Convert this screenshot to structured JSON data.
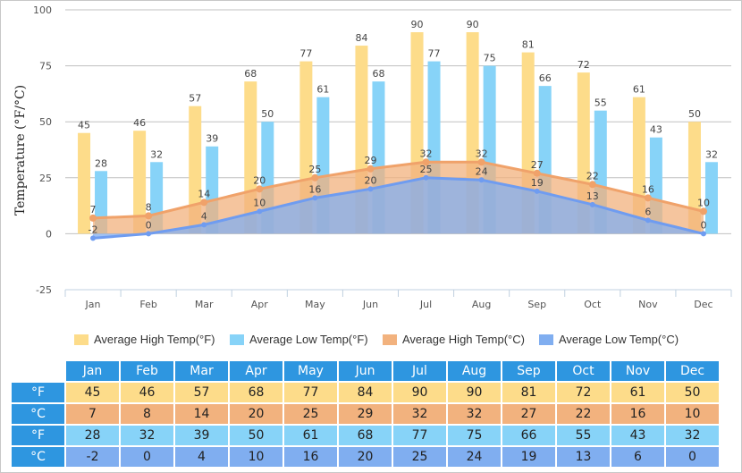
{
  "chart_data": {
    "type": "bar",
    "title": "",
    "xlabel": "",
    "ylabel": "Temperature (°F/°C)",
    "ylim": [
      -25,
      100
    ],
    "yticks": [
      -25,
      0,
      25,
      50,
      75,
      100
    ],
    "grid": true,
    "legend_position": "bottom",
    "categories": [
      "Jan",
      "Feb",
      "Mar",
      "Apr",
      "May",
      "Jun",
      "Jul",
      "Aug",
      "Sep",
      "Oct",
      "Nov",
      "Dec"
    ],
    "series": [
      {
        "name": "Average High Temp(°F)",
        "kind": "bar",
        "color": "#fddc8a",
        "values": [
          45,
          46,
          57,
          68,
          77,
          84,
          90,
          90,
          81,
          72,
          61,
          50
        ]
      },
      {
        "name": "Average Low Temp(°F)",
        "kind": "bar",
        "color": "#87d3f8",
        "values": [
          28,
          32,
          39,
          50,
          61,
          68,
          77,
          75,
          66,
          55,
          43,
          32
        ]
      },
      {
        "name": "Average High Temp(°C)",
        "kind": "area",
        "color": "#f2b27e",
        "values": [
          7,
          8,
          14,
          20,
          25,
          29,
          32,
          32,
          27,
          22,
          16,
          10
        ]
      },
      {
        "name": "Average Low Temp(°C)",
        "kind": "area",
        "color": "#80aef0",
        "values": [
          -2,
          0,
          4,
          10,
          16,
          20,
          25,
          24,
          19,
          13,
          6,
          0
        ]
      }
    ]
  },
  "table": {
    "months": [
      "Jan",
      "Feb",
      "Mar",
      "Apr",
      "May",
      "Jun",
      "Jul",
      "Aug",
      "Sep",
      "Oct",
      "Nov",
      "Dec"
    ],
    "rows": [
      {
        "unit": "°F",
        "values": [
          45,
          46,
          57,
          68,
          77,
          84,
          90,
          90,
          81,
          72,
          61,
          50
        ]
      },
      {
        "unit": "°C",
        "values": [
          7,
          8,
          14,
          20,
          25,
          29,
          32,
          32,
          27,
          22,
          16,
          10
        ]
      },
      {
        "unit": "°F",
        "values": [
          28,
          32,
          39,
          50,
          61,
          68,
          77,
          75,
          66,
          55,
          43,
          32
        ]
      },
      {
        "unit": "°C",
        "values": [
          -2,
          0,
          4,
          10,
          16,
          20,
          25,
          24,
          19,
          13,
          6,
          0
        ]
      }
    ]
  }
}
